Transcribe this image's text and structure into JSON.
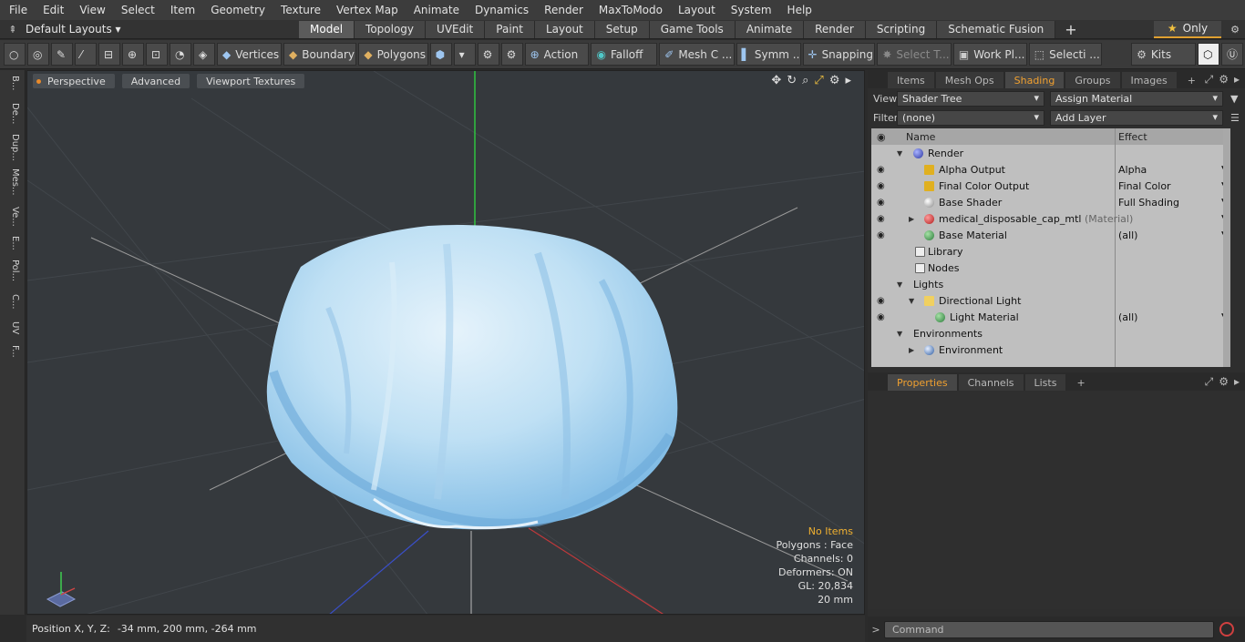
{
  "menu": [
    "File",
    "Edit",
    "View",
    "Select",
    "Item",
    "Geometry",
    "Texture",
    "Vertex Map",
    "Animate",
    "Dynamics",
    "Render",
    "MaxToModo",
    "Layout",
    "System",
    "Help"
  ],
  "layout_bar": {
    "layouts_label": "Default Layouts",
    "tabs": [
      "Model",
      "Topology",
      "UVEdit",
      "Paint",
      "Layout",
      "Setup",
      "Game Tools",
      "Animate",
      "Render",
      "Scripting",
      "Schematic Fusion"
    ],
    "active_tab": "Model",
    "only_label": "Only"
  },
  "toolbar": {
    "vertices": "Vertices",
    "boundary": "Boundary",
    "polygons": "Polygons",
    "action": "Action",
    "falloff": "Falloff",
    "mesh": "Mesh C ...",
    "symm": "Symm ...",
    "snapping": "Snapping",
    "select_t": "Select T...",
    "work_pl": "Work Pl...",
    "selecti": "Selecti ...",
    "kits": "Kits"
  },
  "left_tabs": [
    "B...",
    "De...",
    "Dup...",
    "Mes...",
    "Ve...",
    "E...",
    "Pol...",
    "C...",
    "UV",
    "F..."
  ],
  "viewport": {
    "buttons": [
      "Perspective",
      "Advanced",
      "Viewport Textures"
    ],
    "info": {
      "no_items": "No Items",
      "polygons": "Polygons : Face",
      "channels": "Channels: 0",
      "deformers": "Deformers: ON",
      "gl": "GL: 20,834",
      "unit": "20 mm"
    }
  },
  "position_bar": {
    "label": "Position X, Y, Z:",
    "value": "-34 mm, 200 mm, -264 mm"
  },
  "shading": {
    "tabs": [
      "Items",
      "Mesh Ops",
      "Shading",
      "Groups",
      "Images"
    ],
    "active_tab": "Shading",
    "view_label": "View",
    "view_value": "Shader Tree",
    "assign_material": "Assign Material",
    "filter_label": "Filter",
    "filter_value": "(none)",
    "add_layer": "Add Layer",
    "col_name": "Name",
    "col_effect": "Effect",
    "rows": [
      {
        "name": "Render",
        "effect": "",
        "tag": ""
      },
      {
        "name": "Alpha Output",
        "effect": "Alpha",
        "tag": ""
      },
      {
        "name": "Final Color Output",
        "effect": "Final Color",
        "tag": ""
      },
      {
        "name": "Base Shader",
        "effect": "Full Shading",
        "tag": ""
      },
      {
        "name": "medical_disposable_cap_mtl",
        "effect": "",
        "tag": "(Material)"
      },
      {
        "name": "Base Material",
        "effect": "(all)",
        "tag": ""
      },
      {
        "name": "Library",
        "effect": "",
        "tag": ""
      },
      {
        "name": "Nodes",
        "effect": "",
        "tag": ""
      },
      {
        "name": "Lights",
        "effect": "",
        "tag": ""
      },
      {
        "name": "Directional Light",
        "effect": "",
        "tag": ""
      },
      {
        "name": "Light Material",
        "effect": "(all)",
        "tag": ""
      },
      {
        "name": "Environments",
        "effect": "",
        "tag": ""
      },
      {
        "name": "Environment",
        "effect": "",
        "tag": ""
      }
    ]
  },
  "properties": {
    "tabs": [
      "Properties",
      "Channels",
      "Lists"
    ],
    "active_tab": "Properties"
  },
  "command": {
    "placeholder": "Command"
  }
}
